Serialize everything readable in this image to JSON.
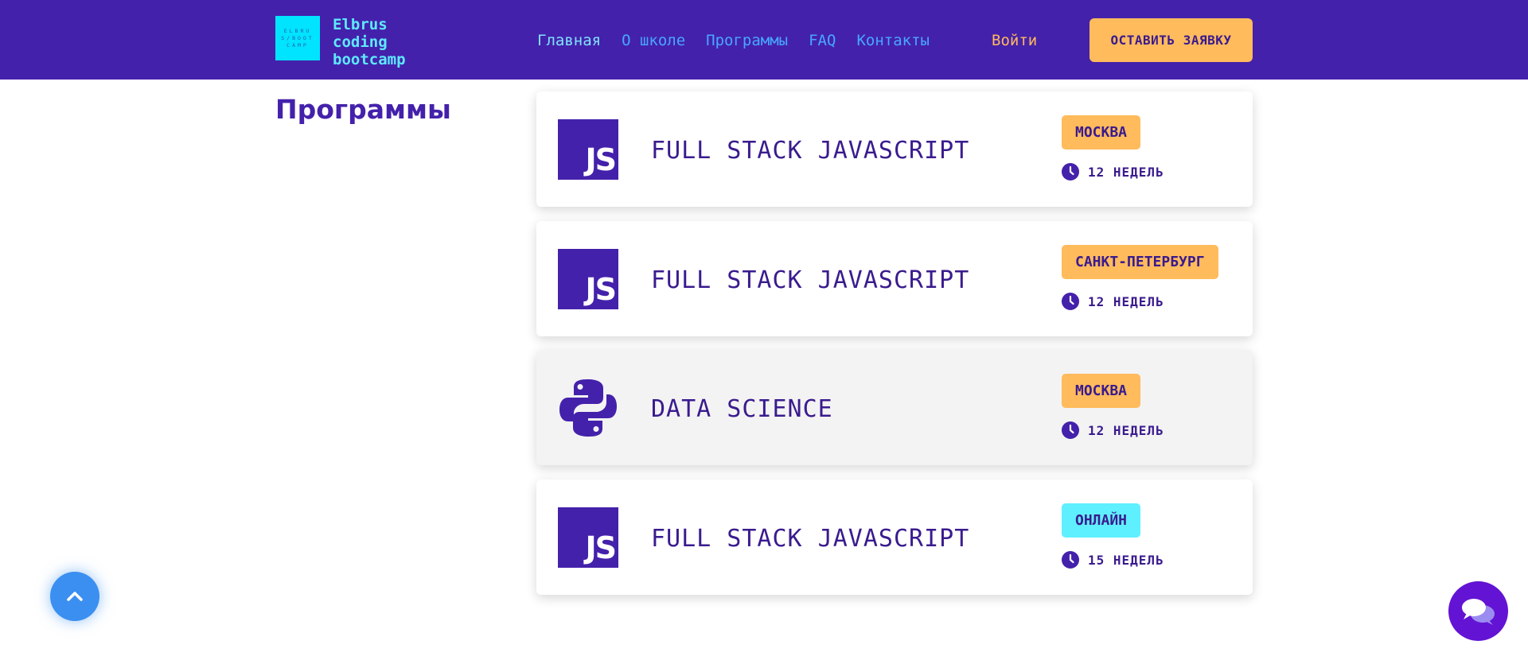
{
  "header": {
    "logo_box_text": "ELBRUS/BOOTCAMP",
    "logo_lines": [
      "Elbrus",
      "coding",
      "bootcamp"
    ],
    "nav": [
      "Главная",
      "О школе",
      "Программы",
      "FAQ",
      "Контакты"
    ],
    "login": "Войти",
    "cta": "ОСТАВИТЬ ЗАЯВКУ"
  },
  "section_title": "Программы",
  "programs": [
    {
      "icon": "js-icon",
      "icon_text": "JS",
      "title": "FULL STACK JAVASCRIPT",
      "city": "МОСКВА",
      "city_color": "#ffbb5c",
      "duration": "12 НЕДЕЛЬ"
    },
    {
      "icon": "js-icon",
      "icon_text": "JS",
      "title": "FULL STACK JAVASCRIPT",
      "city": "САНКТ-ПЕТЕРБУРГ",
      "city_color": "#ffbb5c",
      "duration": "12 НЕДЕЛЬ"
    },
    {
      "icon": "python-icon",
      "title": "DATA SCIENCE",
      "city": "МОСКВА",
      "city_color": "#ffbb5c",
      "duration": "12 НЕДЕЛЬ"
    },
    {
      "icon": "js-icon",
      "icon_text": "JS",
      "title": "FULL STACK JAVASCRIPT",
      "city": "ОНЛАЙН",
      "city_color": "#5ef0ff",
      "duration": "15 НЕДЕЛЬ"
    }
  ],
  "colors": {
    "header_bg": "#4421ab",
    "accent": "#ffbb5c",
    "primary_text": "#3a1b8e",
    "scroll_btn": "#3b8ff0",
    "chat_btn": "#6313d4"
  }
}
